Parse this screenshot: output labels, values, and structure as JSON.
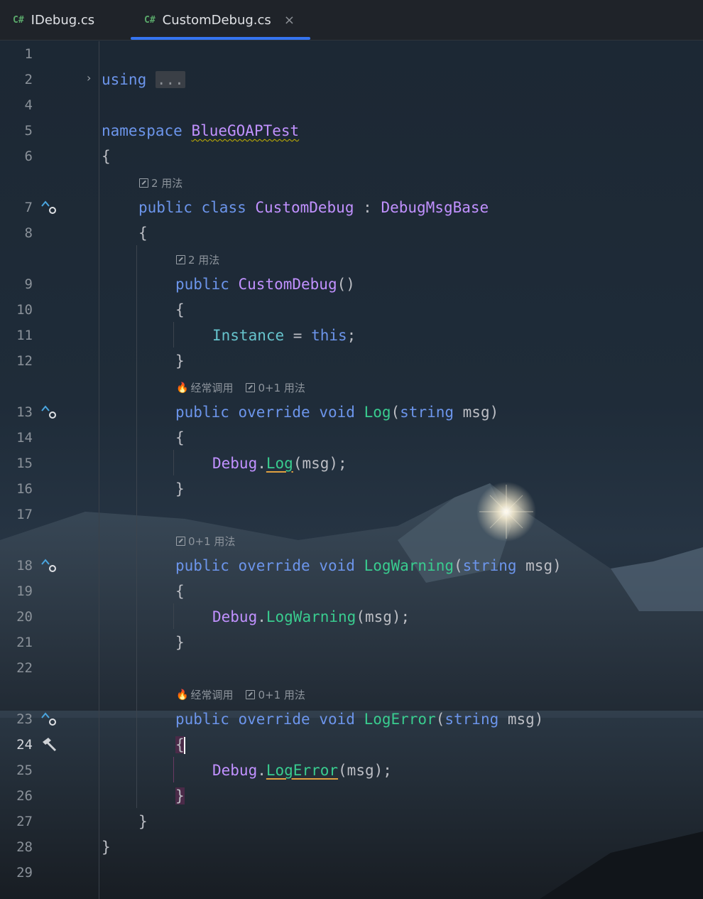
{
  "tabs": [
    {
      "lang": "C#",
      "name": "IDebug.cs",
      "active": false
    },
    {
      "lang": "C#",
      "name": "CustomDebug.cs",
      "active": true,
      "close": "×"
    }
  ],
  "line_numbers": [
    "1",
    "2",
    "4",
    "5",
    "6",
    "7",
    "8",
    "9",
    "10",
    "11",
    "12",
    "13",
    "14",
    "15",
    "16",
    "17",
    "18",
    "19",
    "20",
    "21",
    "22",
    "23",
    "24",
    "25",
    "26",
    "27",
    "28",
    "29"
  ],
  "hints": {
    "usages_2": "2 用法",
    "usages_01": "0+1 用法",
    "frequent": "经常调用"
  },
  "code": {
    "using": "using",
    "fold": "...",
    "namespace_kw": "namespace",
    "namespace_name": "BlueGOAPTest",
    "open_brace": "{",
    "close_brace": "}",
    "public": "public",
    "class": "class",
    "override": "override",
    "void": "void",
    "string": "string",
    "this": "this",
    "class_name": "CustomDebug",
    "colon": ":",
    "base_name": "DebugMsgBase",
    "ctor_parens": "()",
    "instance": "Instance",
    "assign": " = ",
    "semicolon": ";",
    "log": "Log",
    "log_warning": "LogWarning",
    "log_error": "LogError",
    "param_open": "(",
    "param_close": " msg)",
    "debug": "Debug",
    "dot": ".",
    "call_args": "(msg);"
  }
}
